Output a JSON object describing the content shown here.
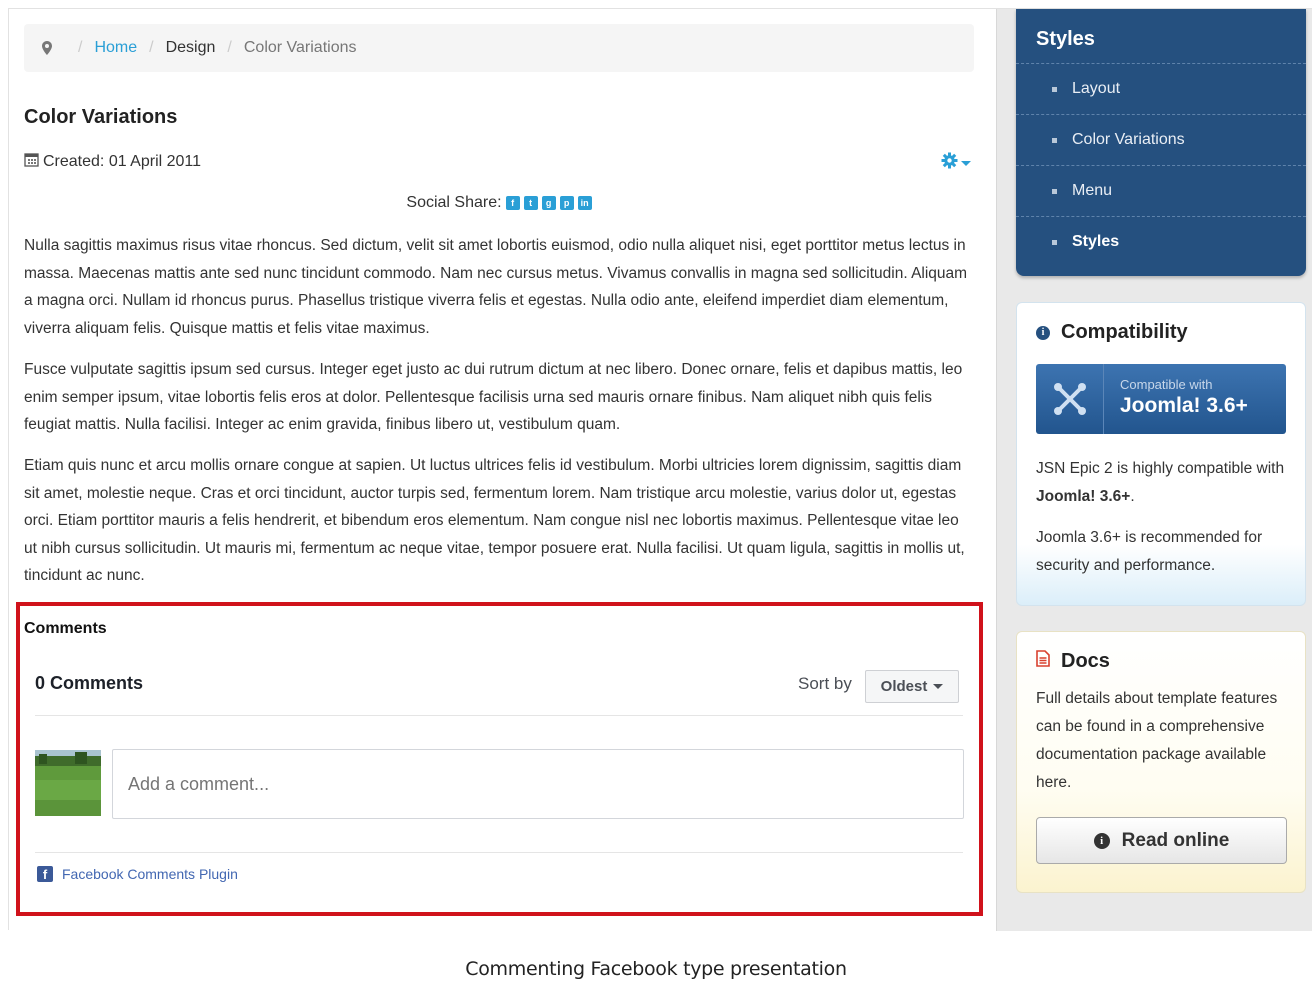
{
  "breadcrumb": {
    "home": "Home",
    "section": "Design",
    "current": "Color Variations"
  },
  "article": {
    "title": "Color Variations",
    "created": "Created: 01 April 2011",
    "social_label": "Social Share:",
    "social_icons": [
      "facebook-icon",
      "twitter-icon",
      "google-plus-icon",
      "pinterest-icon",
      "linkedin-icon"
    ],
    "paragraphs": [
      "Nulla sagittis maximus risus vitae rhoncus. Sed dictum, velit sit amet lobortis euismod, odio nulla aliquet nisi, eget porttitor metus lectus in massa. Maecenas mattis ante sed nunc tincidunt commodo. Nam nec cursus metus. Vivamus convallis in magna sed sollicitudin. Aliquam a magna orci. Nullam id rhoncus purus. Phasellus tristique viverra felis et egestas. Nulla odio ante, eleifend imperdiet diam elementum, viverra aliquam felis. Quisque mattis et felis vitae maximus.",
      "Fusce vulputate sagittis ipsum sed cursus. Integer eget justo ac dui rutrum dictum at nec libero. Donec ornare, felis et dapibus mattis, leo enim semper ipsum, vitae lobortis felis eros at dolor. Pellentesque facilisis urna sed mauris ornare finibus. Nam aliquet nibh quis felis feugiat mattis. Nulla facilisi. Integer ac enim gravida, finibus libero ut, vestibulum quam.",
      "Etiam quis nunc et arcu mollis ornare congue at sapien. Ut luctus ultrices felis id vestibulum. Morbi ultricies lorem dignissim, sagittis diam sit amet, molestie neque. Cras et orci tincidunt, auctor turpis sed, fermentum lorem. Nam tristique arcu molestie, varius dolor ut, egestas orci. Etiam porttitor mauris a felis hendrerit, et bibendum eros elementum. Nam congue nisl nec lobortis maximus. Pellentesque vitae leo ut nibh cursus sollicitudin. Ut mauris mi, fermentum ac neque vitae, tempor posuere erat. Nulla facilisi. Ut quam ligula, sagittis in mollis ut, tincidunt ac nunc."
    ]
  },
  "comments": {
    "heading": "Comments",
    "count": "0 Comments",
    "sort_label": "Sort by",
    "sort_value": "Oldest",
    "placeholder": "Add a comment...",
    "plugin_link": "Facebook Comments Plugin"
  },
  "sidebar": {
    "styles_title": "Styles",
    "menu": [
      {
        "label": "Layout"
      },
      {
        "label": "Color Variations"
      },
      {
        "label": "Menu"
      },
      {
        "label": "Styles"
      }
    ],
    "compat_title": "Compatibility",
    "badge_small": "Compatible with",
    "badge_big": "Joomla! 3.6+",
    "compat_line1_pre": "JSN Epic 2 is highly compatible with ",
    "compat_line1_bold": "Joomla! 3.6+",
    "compat_line1_post": ".",
    "compat_line2": "Joomla 3.6+ is recommended for security and performance.",
    "docs_title": "Docs",
    "docs_text": "Full details about template features can be found in a comprehensive documentation package available here.",
    "read_button": "Read online"
  },
  "caption": "Commenting Facebook type presentation",
  "colors": {
    "link": "#2a9fd6",
    "highlight_border": "#d0121b",
    "styles_panel": "#25507f",
    "facebook": "#3b5998"
  }
}
